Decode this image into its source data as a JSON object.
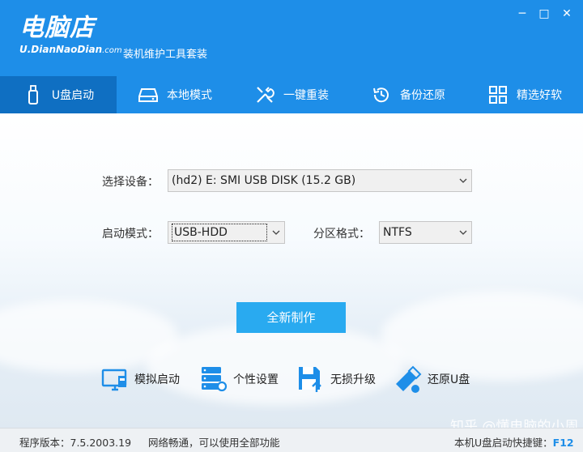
{
  "app": {
    "logo_main": "电脑店",
    "logo_sub": "U.DianNaoDian",
    "logo_domain": ".com",
    "subtitle": "装机维护工具套装"
  },
  "window_controls": [
    "─",
    "□",
    "✕"
  ],
  "nav": {
    "items": [
      {
        "label": "U盘启动",
        "icon": "usb-drive-icon",
        "active": true
      },
      {
        "label": "本地模式",
        "icon": "hard-disk-icon",
        "active": false
      },
      {
        "label": "一键重装",
        "icon": "tools-icon",
        "active": false
      },
      {
        "label": "备份还原",
        "icon": "restore-clock-icon",
        "active": false
      },
      {
        "label": "精选好软",
        "icon": "app-grid-icon",
        "active": false
      }
    ]
  },
  "form": {
    "device_label": "选择设备：",
    "device_value": "(hd2) E: SMI USB DISK (15.2 GB)",
    "boot_mode_label": "启动模式：",
    "boot_mode_value": "USB-HDD",
    "partition_label": "分区格式：",
    "partition_value": "NTFS"
  },
  "create_button": "全新制作",
  "tools": [
    {
      "label": "模拟启动",
      "icon": "monitor-icon"
    },
    {
      "label": "个性设置",
      "icon": "server-settings-icon"
    },
    {
      "label": "无损升级",
      "icon": "save-upgrade-icon"
    },
    {
      "label": "还原U盘",
      "icon": "usb-restore-icon"
    }
  ],
  "status": {
    "version": "程序版本：7.5.2003.19",
    "network": "网络畅通，可以使用全部功能",
    "shortcut_label": "本机U盘启动快捷键：",
    "shortcut_key": "F12"
  },
  "watermark": "知乎 @懂电脑的小周",
  "colors": {
    "accent": "#1e8ee8",
    "active_tab": "#0f6fc2",
    "button": "#29aaf0"
  }
}
